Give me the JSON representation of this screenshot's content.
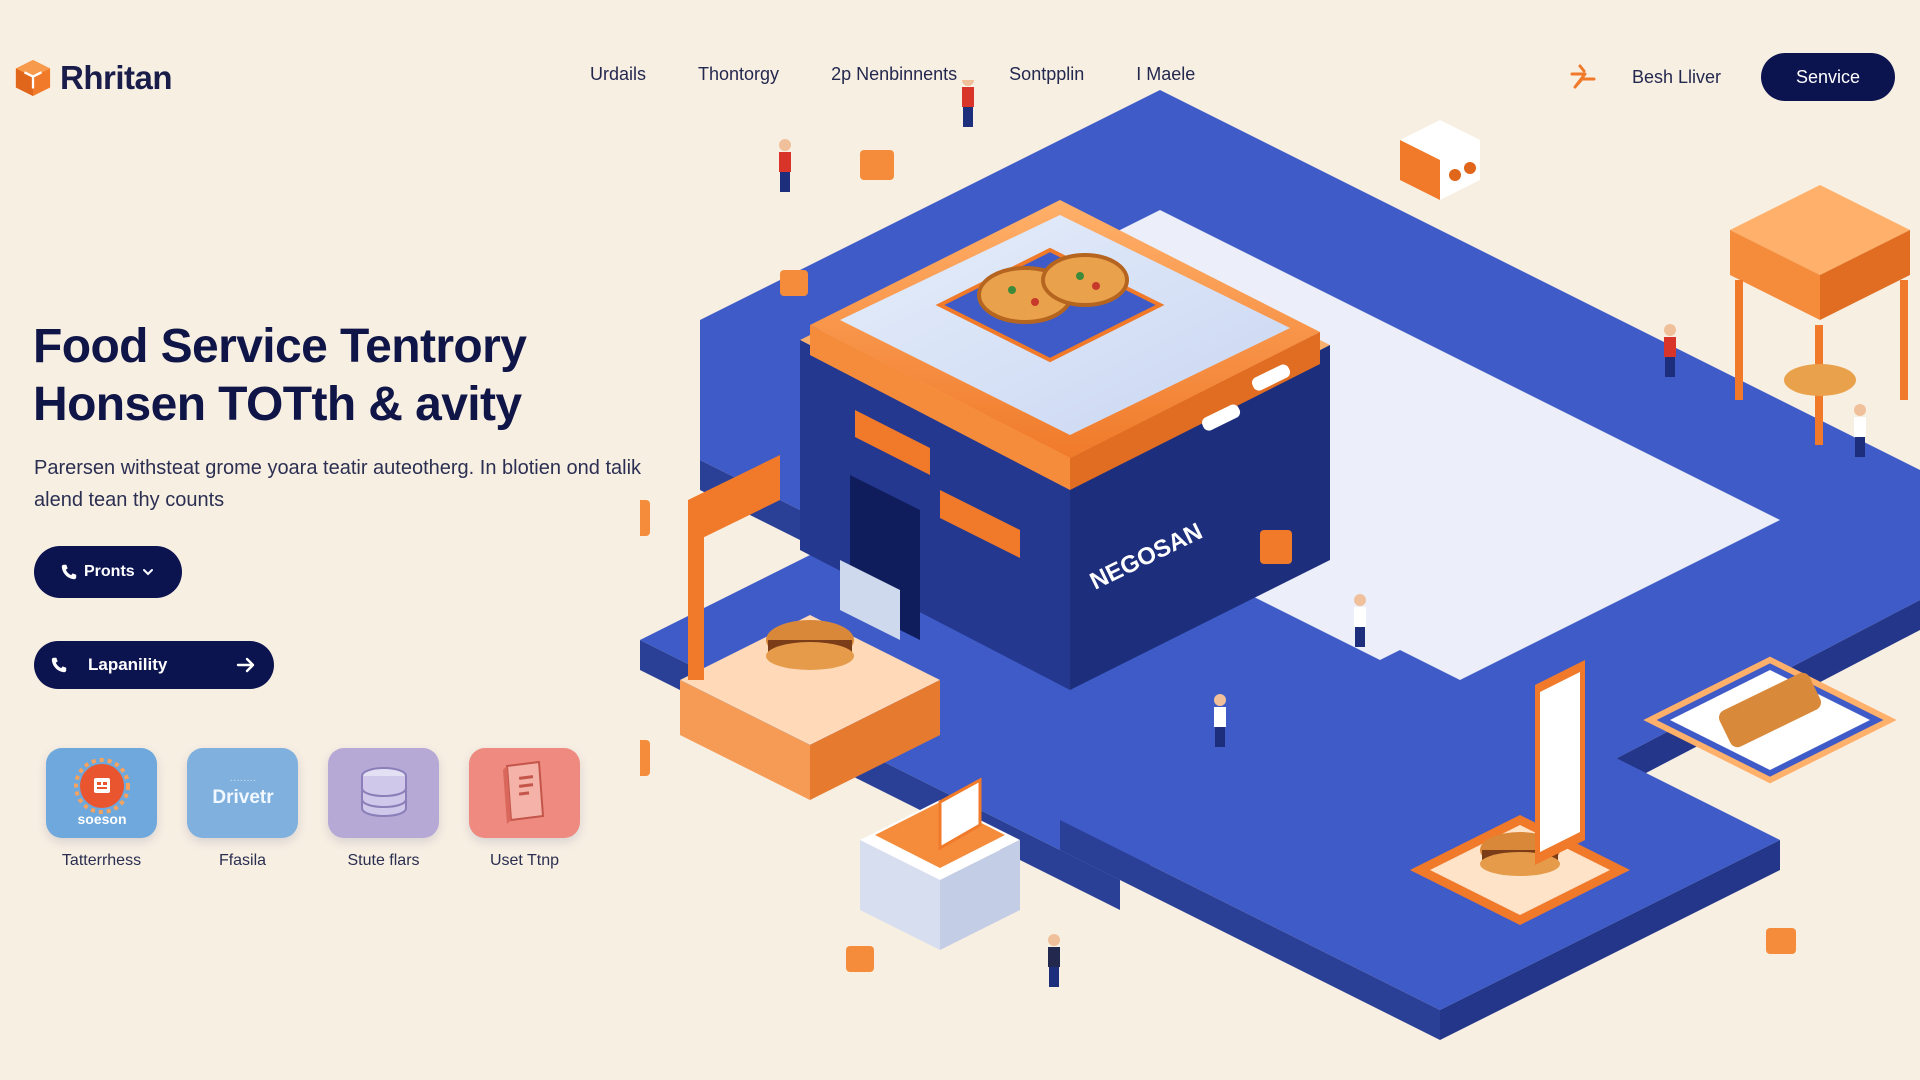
{
  "brand": {
    "name": "Rhritan",
    "accent": "#f07a2a",
    "navy": "#0c1450"
  },
  "nav": {
    "items": [
      "Urdails",
      "Thontorgy",
      "2p Nenbinnents",
      "Sontpplin",
      "I Maele"
    ]
  },
  "header": {
    "login_label": "Besh Lliver",
    "service_label": "Senvice",
    "spark_icon": "spark-icon"
  },
  "hero": {
    "title_line1": "Food Service Tentrory",
    "title_line2": "Honsen TOTth & avity",
    "body": "Parersen withsteat grome yoara teatir auteotherg. In blotien ond talik alend tean thy counts",
    "primary_button": "Pronts",
    "secondary_button": "Lapanility"
  },
  "tiles": [
    {
      "label": "Tatterrhess",
      "icon": "badge-icon",
      "inner_text": "soeson",
      "color": "#6ea8dc"
    },
    {
      "label": "Ffasila",
      "icon": "drive-icon",
      "inner_text": "Drivetr",
      "color": "#7fb0de"
    },
    {
      "label": "Stute flars",
      "icon": "server-icon",
      "color": "#b6a9d6"
    },
    {
      "label": "Uset Ttnp",
      "icon": "book-icon",
      "color": "#ee8a80"
    }
  ],
  "illustration": {
    "building_sign": "NEGOSAN"
  }
}
